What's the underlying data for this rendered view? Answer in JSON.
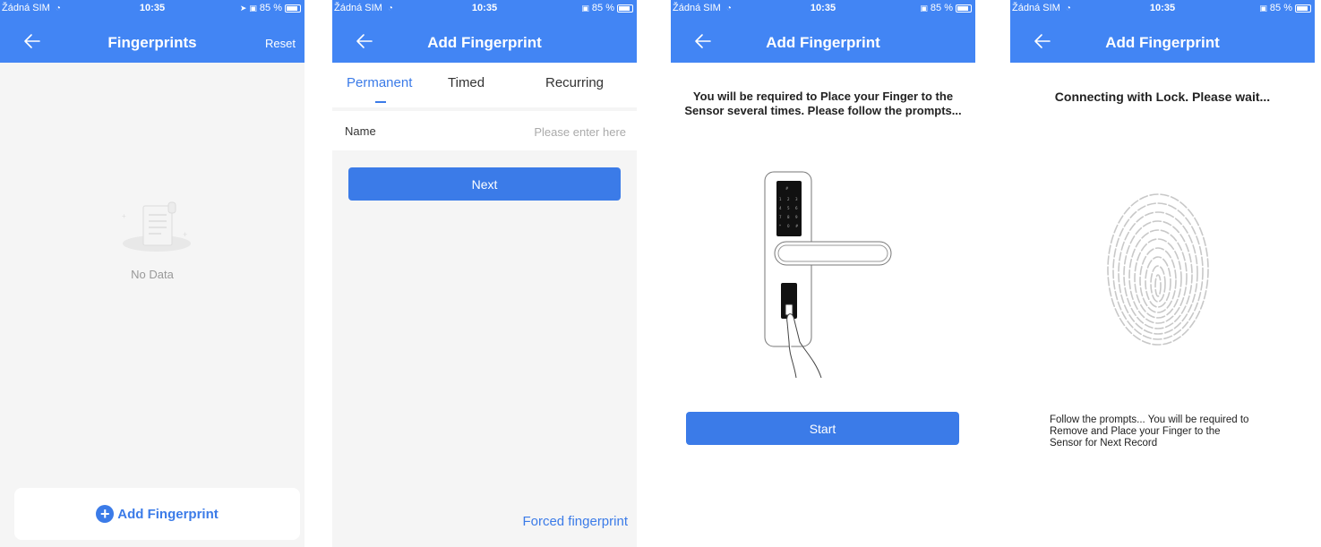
{
  "status_bar": {
    "carrier": "Žádná SIM",
    "time": "10:35",
    "battery": "85 %"
  },
  "screen1": {
    "title": "Fingerprints",
    "reset_label": "Reset",
    "empty_text": "No Data",
    "add_button_label": "Add Fingerprint"
  },
  "screen2": {
    "title": "Add Fingerprint",
    "tabs": [
      "Permanent",
      "Timed",
      "Recurring"
    ],
    "active_tab": "Permanent",
    "name_label": "Name",
    "name_placeholder": "Please enter here",
    "name_value": "",
    "next_label": "Next",
    "forced_label": "Forced fingerprint"
  },
  "screen3": {
    "title": "Add Fingerprint",
    "instruction": "You will be required to Place your Finger to the Sensor several times. Please follow the prompts...",
    "start_label": "Start"
  },
  "screen4": {
    "title": "Add Fingerprint",
    "connecting_text": "Connecting with Lock. Please wait...",
    "follow_text": "Follow the prompts... You will be required to Remove and Place your Finger to the Sensor for Next Record"
  },
  "colors": {
    "header": "#4285f4",
    "accent": "#3b7be8",
    "background": "#f5f5f5"
  },
  "icons": [
    "back-arrow-icon",
    "wifi-icon",
    "location-icon",
    "lock-icon",
    "battery-icon",
    "plus-circle-icon",
    "empty-document-icon",
    "door-lock-illustration",
    "fingerprint-icon"
  ]
}
